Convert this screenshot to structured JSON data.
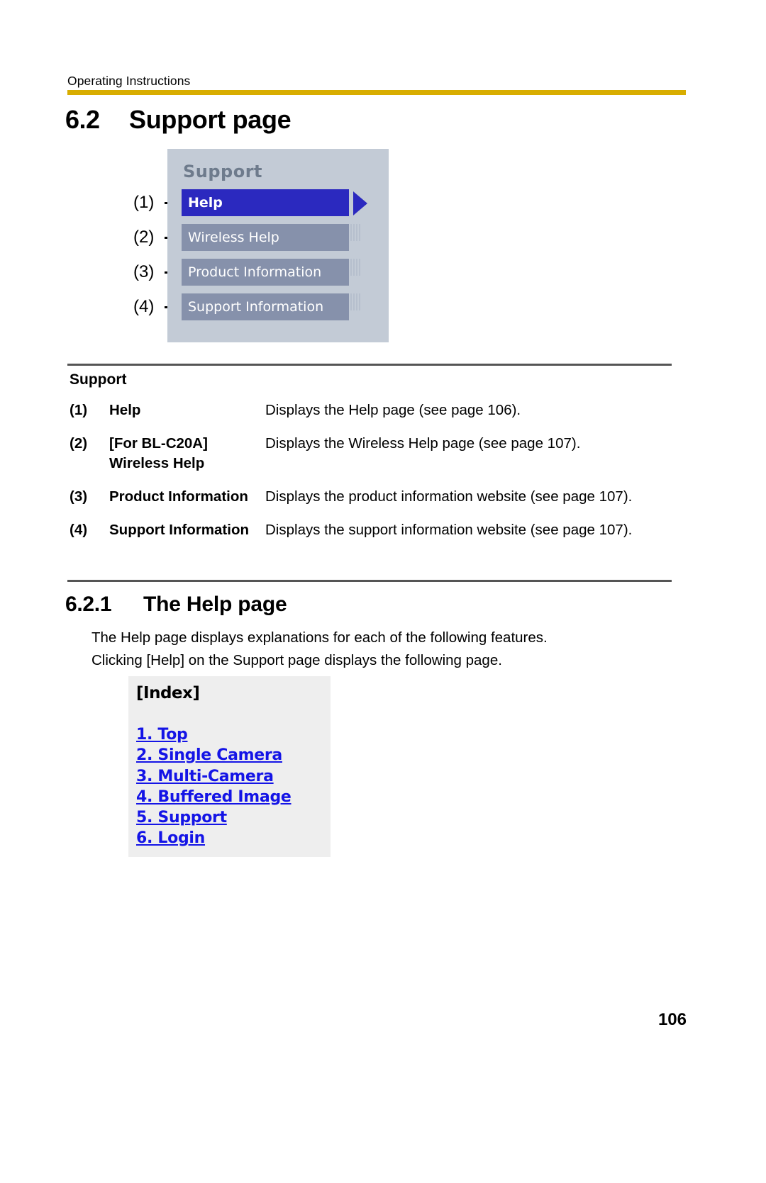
{
  "header": {
    "running_title": "Operating Instructions",
    "rule_color": "#d8ad00"
  },
  "section": {
    "number": "6.2",
    "title": "Support page"
  },
  "figure_support": {
    "title": "Support",
    "bg_color": "#c3cbd6",
    "selected_color": "#2b29bf",
    "item_color": "#8691ab",
    "items": [
      {
        "callout": "(1)",
        "label": "Help",
        "selected": true
      },
      {
        "callout": "(2)",
        "label": "Wireless Help",
        "selected": false
      },
      {
        "callout": "(3)",
        "label": "Product Information",
        "selected": false
      },
      {
        "callout": "(4)",
        "label": "Support Information",
        "selected": false
      }
    ]
  },
  "table": {
    "caption": "Support",
    "rows": [
      {
        "num": "(1)",
        "label": "Help",
        "desc": "Displays the Help page (see page 106)."
      },
      {
        "num": "(2)",
        "label": "[For BL-C20A] Wireless Help",
        "desc": "Displays the Wireless Help page (see page 107)."
      },
      {
        "num": "(3)",
        "label": "Product Information",
        "desc": "Displays the product information website (see page 107)."
      },
      {
        "num": "(4)",
        "label": "Support Information",
        "desc": "Displays the support information website (see page 107)."
      }
    ]
  },
  "subsection": {
    "number": "6.2.1",
    "title": "The Help page",
    "paragraph_line1": "The Help page displays explanations for each of the following features.",
    "paragraph_line2": "Clicking [Help] on the Support page displays the following page."
  },
  "figure_index": {
    "title": "[Index]",
    "bg_color": "#eeeeee",
    "link_color": "#1414e6",
    "links": [
      "1. Top",
      "2. Single Camera",
      "3. Multi-Camera",
      "4. Buffered Image",
      "5. Support",
      "6. Login"
    ]
  },
  "folio": "106"
}
